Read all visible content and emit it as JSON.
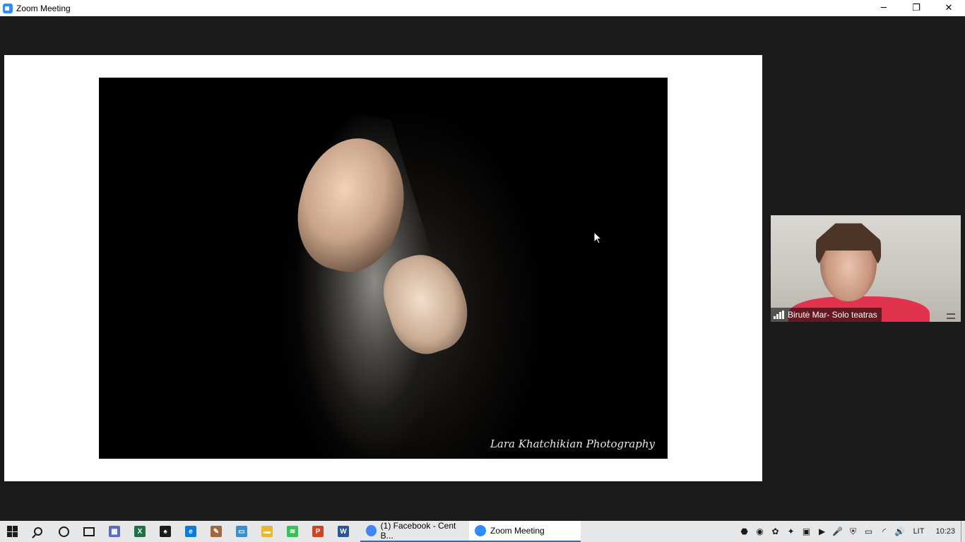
{
  "window": {
    "title": "Zoom Meeting",
    "minimize_glyph": "─",
    "restore_glyph": "❐",
    "close_glyph": "✕"
  },
  "share": {
    "watermark": "Lara Khatchikian Photography"
  },
  "participant": {
    "name": "Birutė Mar- Solo teatras"
  },
  "taskbar": {
    "pinned": [
      {
        "name": "calculator-icon",
        "label": "▦",
        "color": "#5c6bc0"
      },
      {
        "name": "excel-icon",
        "label": "X",
        "color": "#1f7244"
      },
      {
        "name": "solitaire-icon",
        "label": "♠",
        "color": "#1b1b1b"
      },
      {
        "name": "edge-icon",
        "label": "e",
        "color": "#0f7bd8"
      },
      {
        "name": "paint-icon",
        "label": "✎",
        "color": "#a2683b"
      },
      {
        "name": "remote-desktop-icon",
        "label": "▭",
        "color": "#3a8fd1"
      },
      {
        "name": "file-explorer-icon",
        "label": "▬",
        "color": "#e8b632"
      },
      {
        "name": "spotify-icon",
        "label": "≋",
        "color": "#33c35a"
      },
      {
        "name": "powerpoint-icon",
        "label": "P",
        "color": "#d04423"
      },
      {
        "name": "word-icon",
        "label": "W",
        "color": "#2b5797"
      }
    ],
    "open_apps": [
      {
        "name": "chrome-facebook-task",
        "label": "(1) Facebook - Cent B...",
        "icon_color": "#4285f4"
      },
      {
        "name": "zoom-meeting-task",
        "label": "Zoom Meeting",
        "icon_color": "#2d8cff"
      }
    ],
    "tray_glyphs": [
      "⬣",
      "◉",
      "✿",
      "✦",
      "▣",
      "▶",
      "🎤",
      "⛨",
      "▭",
      "◜",
      "🔊"
    ],
    "language": "LIT",
    "clock": "10:23"
  }
}
